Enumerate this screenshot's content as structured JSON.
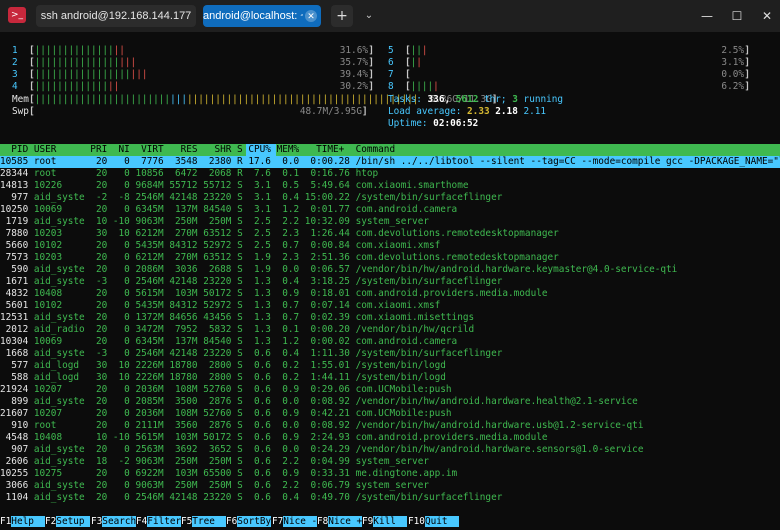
{
  "titlebar": {
    "app_icon": "terminal-icon",
    "tabs": [
      {
        "label": "ssh android@192.168.144.177"
      },
      {
        "label": "android@localhost: ~"
      }
    ],
    "new_tab": "+",
    "dropdown": "⌄",
    "minimize": "—",
    "maximize": "☐",
    "close": "✕"
  },
  "cpus": [
    {
      "id": "1",
      "bar": "||||||||||||||||",
      "pct": "31.6%",
      "level": 0.316
    },
    {
      "id": "2",
      "bar": "||||||||||||||||||",
      "pct": "35.7%",
      "level": 0.357
    },
    {
      "id": "3",
      "bar": "||||||||||||||||||||",
      "pct": "39.4%",
      "level": 0.394
    },
    {
      "id": "4",
      "bar": "|||||||||||||||",
      "pct": "30.2%",
      "level": 0.302
    },
    {
      "id": "5",
      "bar": "|||",
      "pct": "2.5%",
      "level": 0.025
    },
    {
      "id": "6",
      "bar": "||",
      "pct": "3.1%",
      "level": 0.031
    },
    {
      "id": "7",
      "bar": "",
      "pct": "0.0%",
      "level": 0.0
    },
    {
      "id": "8",
      "bar": "|||||",
      "pct": "6.2%",
      "level": 0.062
    }
  ],
  "mem": {
    "label": "Mem",
    "bar": "||||||||||||||||||||||||||||||||||||||||||||||||||||||||||||||||||||",
    "value": "6.36G/11.3G"
  },
  "swp": {
    "label": "Swp",
    "bar": "",
    "value": "48.7M/3.95G"
  },
  "tasks": {
    "label": "Tasks:",
    "count": "336,",
    "thr": "5612",
    "thr_label": "thr;",
    "running": "3",
    "running_label": "running"
  },
  "load": {
    "label": "Load average:",
    "v1": "2.33",
    "v2": "2.18",
    "v3": "2.11"
  },
  "uptime": {
    "label": "Uptime:",
    "value": "02:06:52"
  },
  "header_line": "  PID USER      PRI  NI  VIRT   RES   SHR S CPU% MEM%   TIME+  Command",
  "processes": [
    "10585 root       20   0  7776  3548  2380 R 17.6  0.0  0:00.28 /bin/sh ../../libtool --silent --tag=CC --mode=compile gcc -DPACKAGE_NAME=\"l",
    "28344 root       20   0 10856  6472  2068 R  7.6  0.1  0:16.76 htop",
    "14813 10226      20   0 9684M 55712 55712 S  3.1  0.5  5:49.64 com.xiaomi.smarthome",
    "  977 aid_syste  -2  -8 2546M 42148 23220 S  3.1  0.4 15:00.22 /system/bin/surfaceflinger",
    "10250 10069      20   0 6345M  137M 84540 S  3.1  1.2  0:01.77 com.android.camera",
    " 1719 aid_syste  10 -10 9063M  250M  250M S  2.5  2.2 10:32.09 system_server",
    " 7880 10203      30  10 6212M  270M 63512 S  2.5  2.3  1:26.44 com.devolutions.remotedesktopmanager",
    " 5660 10102      20   0 5435M 84312 52972 S  2.5  0.7  0:00.84 com.xiaomi.xmsf",
    " 7573 10203      20   0 6212M  270M 63512 S  1.9  2.3  2:51.36 com.devolutions.remotedesktopmanager",
    "  590 aid_syste  20   0 2086M  3036  2688 S  1.9  0.0  0:06.57 /vendor/bin/hw/android.hardware.keymaster@4.0-service-qti",
    " 1671 aid_syste  -3   0 2546M 42148 23220 S  1.3  0.4  3:18.25 /system/bin/surfaceflinger",
    " 4832 10408      20   0 5615M  103M 50172 S  1.3  0.9  0:18.01 com.android.providers.media.module",
    " 5601 10102      20   0 5435M 84312 52972 S  1.3  0.7  0:07.14 com.xiaomi.xmsf",
    "12531 aid_syste  20   0 1372M 84656 43456 S  1.3  0.7  0:02.39 com.xiaomi.misettings",
    " 2012 aid_radio  20   0 3472M  7952  5832 S  1.3  0.1  0:00.20 /vendor/bin/hw/qcrild",
    "10304 10069      20   0 6345M  137M 84540 S  1.3  1.2  0:00.02 com.android.camera",
    " 1668 aid_syste  -3   0 2546M 42148 23220 S  0.6  0.4  1:11.30 /system/bin/surfaceflinger",
    "  577 aid_logd   30  10 2226M 18780  2800 S  0.6  0.2  1:55.01 /system/bin/logd",
    "  588 aid_logd   30  10 2226M 18780  2800 S  0.6  0.2  1:44.11 /system/bin/logd",
    "21924 10207      20   0 2036M  108M 52760 S  0.6  0.9  0:29.06 com.UCMobile:push",
    "  899 aid_syste  20   0 2085M  3500  2876 S  0.6  0.0  0:08.92 /vendor/bin/hw/android.hardware.health@2.1-service",
    "21607 10207      20   0 2036M  108M 52760 S  0.6  0.9  0:42.21 com.UCMobile:push",
    "  910 root       20   0 2111M  3560  2876 S  0.6  0.0  0:08.92 /vendor/bin/hw/android.hardware.usb@1.2-service-qti",
    " 4548 10408      10 -10 5615M  103M 50172 S  0.6  0.9  2:24.93 com.android.providers.media.module",
    "  907 aid_syste  20   0 2563M  3692  3652 S  0.6  0.0  0:24.29 /vendor/bin/hw/android.hardware.sensors@1.0-service",
    " 2606 aid_syste  18  -2 9063M  250M  250M S  0.6  2.2  0:04.99 system_server",
    "10255 10275      20   0 6922M  103M 65500 S  0.6  0.9  0:33.31 me.dingtone.app.im",
    " 3066 aid_syste  20   0 9063M  250M  250M S  0.6  2.2  0:06.79 system_server",
    " 1104 aid_syste  20   0 2546M 42148 23220 S  0.6  0.4  0:49.70 /system/bin/surfaceflinger"
  ],
  "fkeys": [
    {
      "key": "F1",
      "label": "Help  "
    },
    {
      "key": "F2",
      "label": "Setup "
    },
    {
      "key": "F3",
      "label": "Search"
    },
    {
      "key": "F4",
      "label": "Filter"
    },
    {
      "key": "F5",
      "label": "Tree  "
    },
    {
      "key": "F6",
      "label": "SortBy"
    },
    {
      "key": "F7",
      "label": "Nice -"
    },
    {
      "key": "F8",
      "label": "Nice +"
    },
    {
      "key": "F9",
      "label": "Kill  "
    },
    {
      "key": "F10",
      "label": "Quit  "
    }
  ],
  "colors": {
    "accent": "#0f6cbd",
    "green": "#3fb950",
    "cyan": "#48c8ff",
    "red": "#e5534b"
  }
}
